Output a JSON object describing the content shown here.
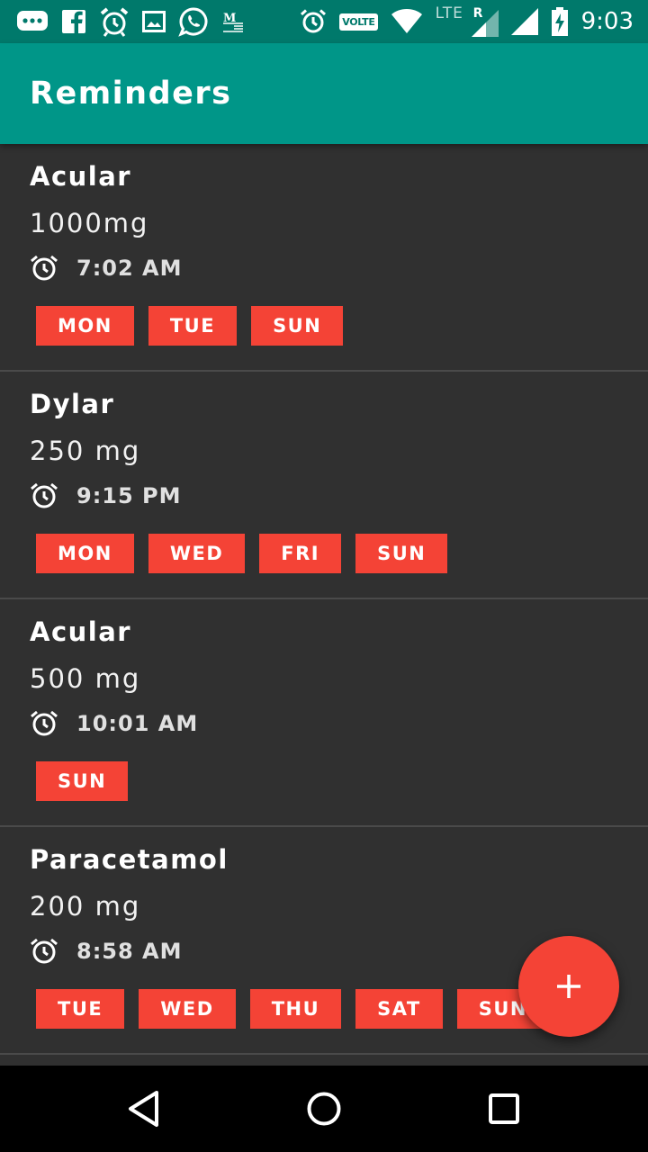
{
  "status_bar": {
    "time": "9:03",
    "volte": "VOLTE",
    "lte": "LTE",
    "roaming": "R",
    "left_icons": [
      "chat-icon",
      "facebook-icon",
      "alarm-clock-icon",
      "image-icon",
      "whatsapp-icon",
      "gmail-icon"
    ],
    "right_icons": [
      "alarm-icon",
      "volte-icon",
      "wifi-icon",
      "lte-signal-icon",
      "signal-icon",
      "battery-charging-icon"
    ]
  },
  "app_bar": {
    "title": "Reminders"
  },
  "reminders": [
    {
      "name": "Acular",
      "dose": "1000mg",
      "time": "7:02 AM",
      "days": [
        "MON",
        "TUE",
        "SUN"
      ]
    },
    {
      "name": "Dylar",
      "dose": "250 mg",
      "time": "9:15 PM",
      "days": [
        "MON",
        "WED",
        "FRI",
        "SUN"
      ]
    },
    {
      "name": "Acular",
      "dose": "500 mg",
      "time": "10:01 AM",
      "days": [
        "SUN"
      ]
    },
    {
      "name": "Paracetamol",
      "dose": "200 mg",
      "time": "8:58 AM",
      "days": [
        "TUE",
        "WED",
        "THU",
        "SAT",
        "SUN"
      ]
    }
  ],
  "fab": {
    "icon": "plus-icon"
  },
  "nav_bar": {
    "buttons": [
      "back-icon",
      "home-icon",
      "recents-icon"
    ]
  },
  "colors": {
    "status_bar": "#00796b",
    "app_bar": "#009688",
    "background": "#303030",
    "chip": "#f44336",
    "fab": "#f44336"
  }
}
